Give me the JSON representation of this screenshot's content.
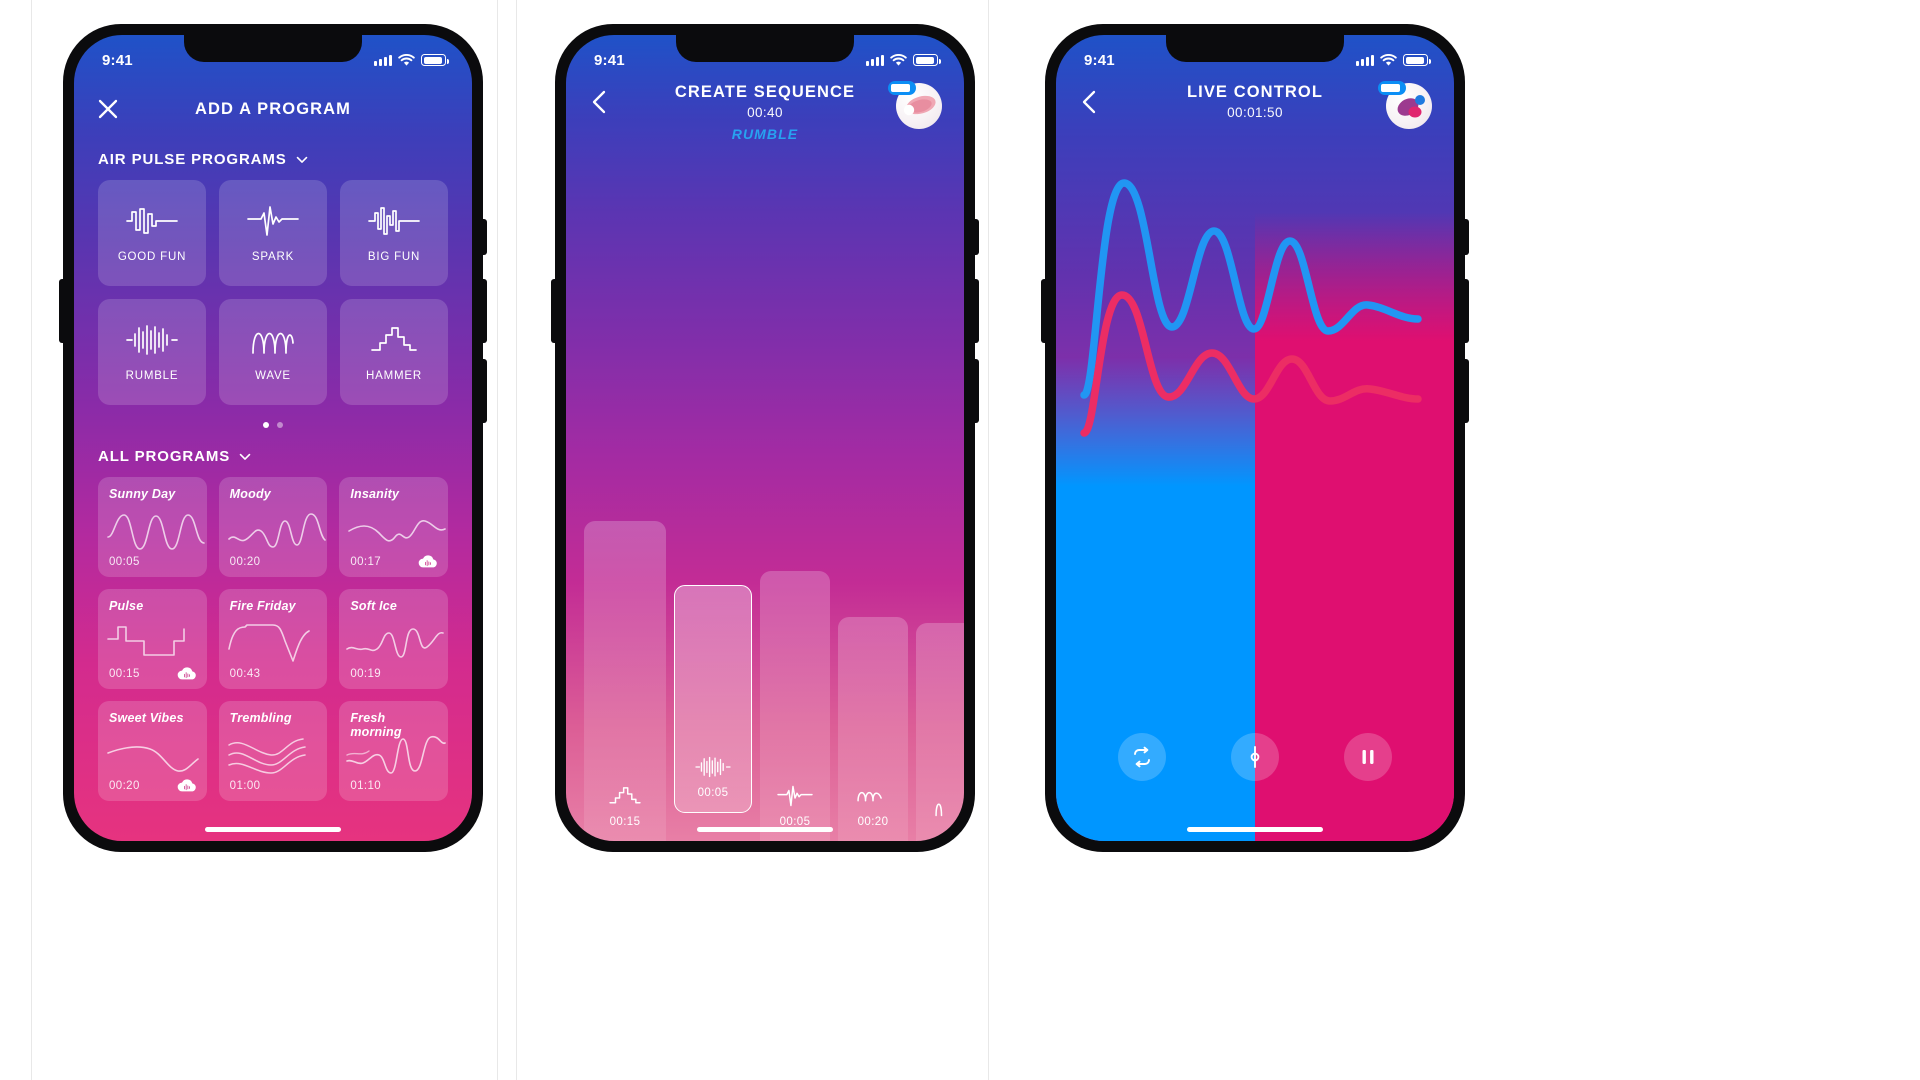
{
  "screens": [
    {
      "id": "add-a-program",
      "status": {
        "time": "9:41"
      },
      "nav": {
        "close_icon": "close-icon",
        "title": "ADD A PROGRAM"
      },
      "sections": [
        {
          "title": "AIR PULSE PROGRAMS",
          "chevron": "chevron-down-icon"
        },
        {
          "title": "ALL PROGRAMS",
          "chevron": "chevron-down-icon"
        }
      ],
      "pulse_programs": [
        {
          "label": "GOOD FUN",
          "icon": "waveform-good-fun-icon"
        },
        {
          "label": "SPARK",
          "icon": "waveform-spark-icon"
        },
        {
          "label": "BIG FUN",
          "icon": "waveform-big-fun-icon"
        },
        {
          "label": "RUMBLE",
          "icon": "waveform-rumble-icon"
        },
        {
          "label": "WAVE",
          "icon": "waveform-wave-icon"
        },
        {
          "label": "HAMMER",
          "icon": "waveform-hammer-icon"
        }
      ],
      "pager": {
        "pages": 2,
        "active": 0
      },
      "all_programs": [
        {
          "name": "Sunny Day",
          "time": "00:05",
          "cloud": false
        },
        {
          "name": "Moody",
          "time": "00:20",
          "cloud": false
        },
        {
          "name": "Insanity",
          "time": "00:17",
          "cloud": true
        },
        {
          "name": "Pulse",
          "time": "00:15",
          "cloud": true
        },
        {
          "name": "Fire Friday",
          "time": "00:43",
          "cloud": false
        },
        {
          "name": "Soft Ice",
          "time": "00:19",
          "cloud": false
        },
        {
          "name": "Sweet Vibes",
          "time": "00:20",
          "cloud": true
        },
        {
          "name": "Trembling",
          "time": "01:00",
          "cloud": false
        },
        {
          "name": "Fresh  morning",
          "time": "01:10",
          "cloud": false
        }
      ]
    },
    {
      "id": "create-sequence",
      "status": {
        "time": "9:41"
      },
      "nav": {
        "back_icon": "chevron-left-icon",
        "title": "CREATE SEQUENCE",
        "subtitle": "00:40",
        "program": "RUMBLE",
        "avatar": "device-avatar",
        "battery_pill": "battery-pill"
      },
      "sequence_bars": [
        {
          "time": "00:15",
          "icon": "waveform-hammer-icon",
          "selected": false
        },
        {
          "time": "00:05",
          "icon": "waveform-rumble-icon",
          "selected": true
        },
        {
          "time": "00:05",
          "icon": "waveform-spark-icon",
          "selected": false
        },
        {
          "time": "00:20",
          "icon": "waveform-wave-icon",
          "selected": false
        },
        {
          "time": "",
          "icon": "waveform-partial-icon",
          "selected": false
        }
      ]
    },
    {
      "id": "live-control",
      "status": {
        "time": "9:41"
      },
      "nav": {
        "back_icon": "chevron-left-icon",
        "title": "LIVE CONTROL",
        "subtitle": "00:01:50",
        "avatar": "device-avatar",
        "battery_pill": "battery-pill"
      },
      "controls": [
        {
          "name": "loop-button",
          "icon": "loop-icon"
        },
        {
          "name": "sync-button",
          "icon": "sync-handle-icon"
        },
        {
          "name": "pause-button",
          "icon": "pause-icon"
        }
      ],
      "colors": {
        "blue": "#0096ff",
        "pink": "#df0f70",
        "accent": "#27a2f0"
      }
    }
  ]
}
